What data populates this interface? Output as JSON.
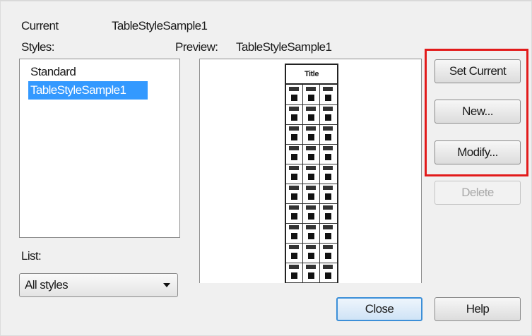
{
  "current": {
    "label": "Current",
    "value": "TableStyleSample1"
  },
  "styles": {
    "label": "Styles:",
    "items": [
      {
        "label": "Standard",
        "selected": false
      },
      {
        "label": "TableStyleSample1",
        "selected": true
      }
    ]
  },
  "preview": {
    "label": "Preview:",
    "style_name": "TableStyleSample1",
    "table_title": "Title"
  },
  "buttons": {
    "set_current": "Set Current",
    "new": "New...",
    "modify": "Modify...",
    "delete": "Delete",
    "close": "Close",
    "help": "Help"
  },
  "list_filter": {
    "label": "List:",
    "selected": "All styles"
  },
  "colors": {
    "selection": "#3399ff",
    "highlight_box": "#e21b1b"
  }
}
